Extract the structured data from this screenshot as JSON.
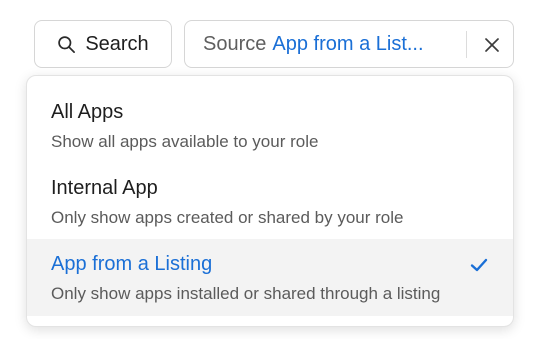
{
  "toolbar": {
    "search_button": {
      "icon": "search-icon",
      "label": "Search"
    },
    "source_filter": {
      "label": "Source",
      "value": "App from a List...",
      "clear_icon": "close-icon"
    }
  },
  "dropdown": {
    "options": [
      {
        "title": "All Apps",
        "description": "Show all apps available to your role",
        "selected": false
      },
      {
        "title": "Internal App",
        "description": "Only show apps created or shared by your role",
        "selected": false
      },
      {
        "title": "App from a Listing",
        "description": "Only show apps installed or shared through a listing",
        "selected": true,
        "check_icon": "checkmark-icon"
      }
    ]
  },
  "colors": {
    "accent": "#1a6fd6",
    "selected_background": "#f3f3f3",
    "border": "#d6d6d6"
  }
}
